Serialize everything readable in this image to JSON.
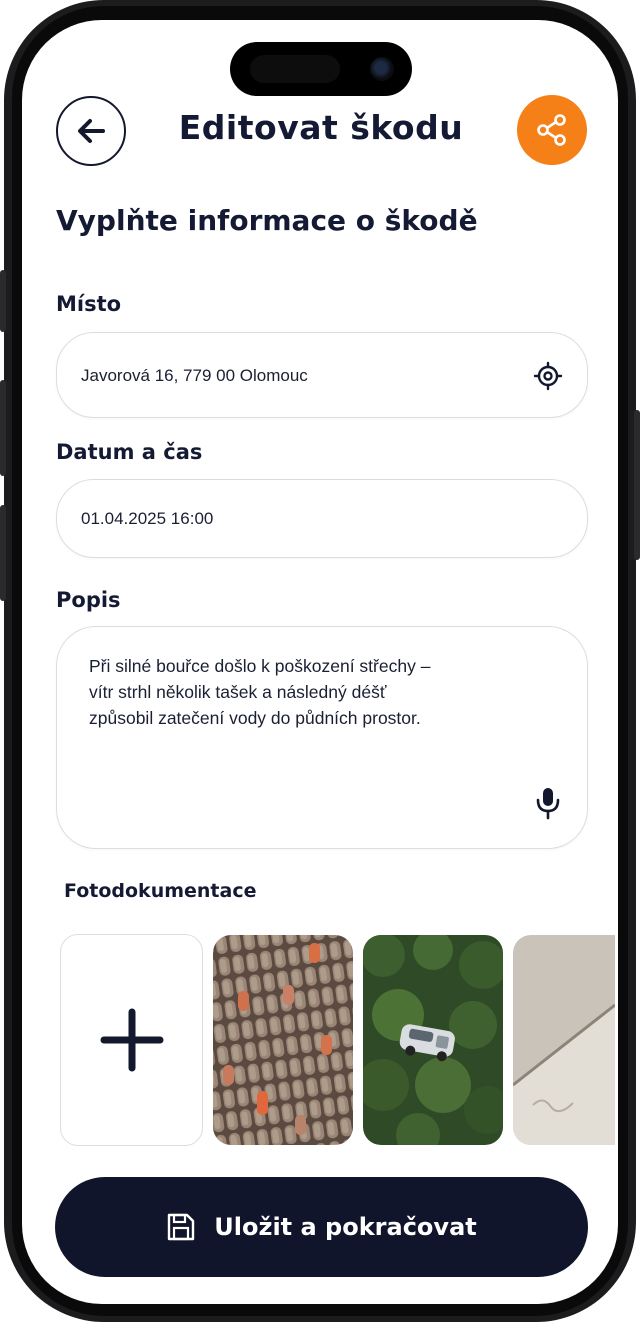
{
  "header": {
    "title": "Editovat škodu",
    "back_icon": "arrow-left-icon",
    "share_icon": "share-icon"
  },
  "form": {
    "subtitle": "Vyplňte informace o škodě",
    "location": {
      "label": "Místo",
      "value": "Javorová 16, 779 00 Olomouc",
      "icon": "locate-target-icon"
    },
    "datetime": {
      "label": "Datum a čas",
      "value": "01.04.2025 16:00"
    },
    "description": {
      "label": "Popis",
      "line1": "Při silné bouřce došlo k poškození střechy –",
      "line2": "vítr strhl několik tašek a následný déšť",
      "line3": "způsobil zatečení vody do půdních prostor.",
      "icon": "microphone-icon"
    }
  },
  "photos": {
    "label": "Fotodokumentace",
    "add_icon": "plus-icon",
    "items": [
      "roof-tiles-photo",
      "damaged-car-photo",
      "wall-crack-photo"
    ]
  },
  "actions": {
    "save_label": "Uložit a pokračovat",
    "save_icon": "floppy-disk-icon"
  },
  "colors": {
    "primary": "#11152c",
    "accent": "#f58018",
    "text": "#141a33",
    "border": "#dcdde3"
  }
}
